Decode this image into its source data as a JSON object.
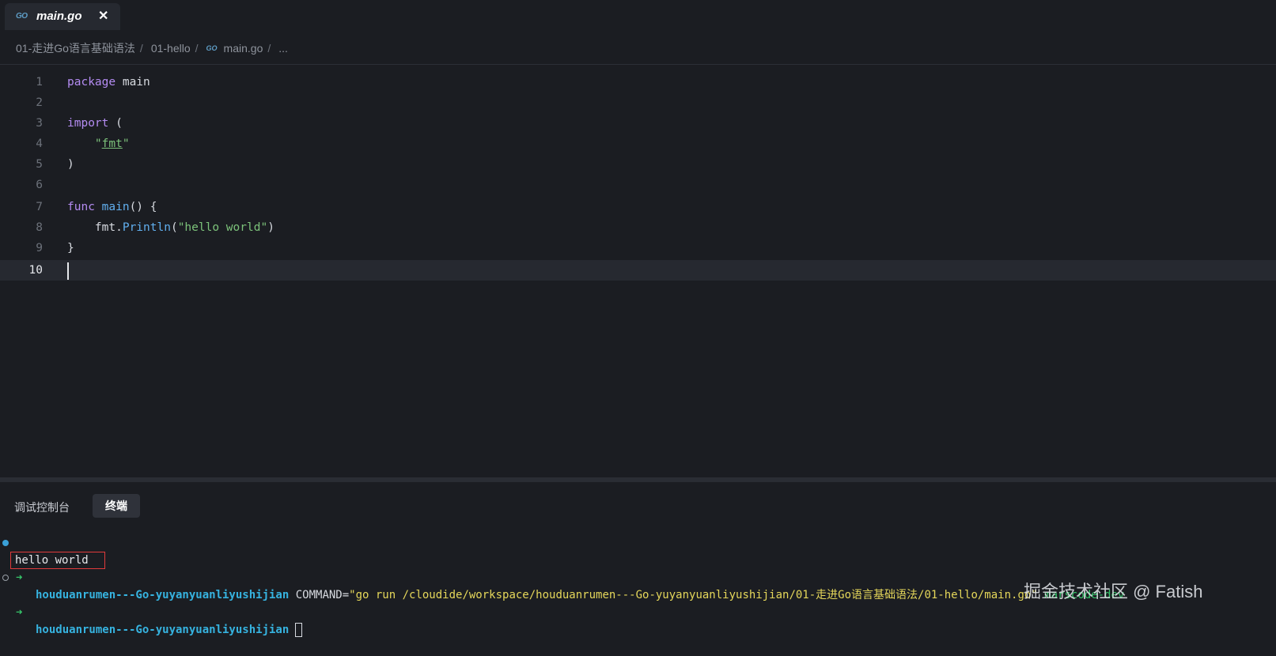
{
  "tab": {
    "icon": "GO",
    "label": "main.go",
    "close": "✕"
  },
  "breadcrumb": {
    "items": [
      "01-走进Go语言基础语法",
      "01-hello",
      "main.go",
      "..."
    ],
    "separator": "/",
    "file_icon": "GO"
  },
  "editor": {
    "line_numbers": [
      "1",
      "2",
      "3",
      "4",
      "5",
      "6",
      "7",
      "8",
      "9",
      "10"
    ],
    "active_line": 10,
    "code": {
      "l1_kw": "package",
      "l1_name": " main",
      "l3_kw": "import",
      "l3_rest": " (",
      "l4_indent": "    ",
      "l4_q1": "\"",
      "l4_str": "fmt",
      "l4_q2": "\"",
      "l5": ")",
      "l7_kw": "func",
      "l7_sp": " ",
      "l7_fn": "main",
      "l7_rest": "() {",
      "l8_indent": "    ",
      "l8_pkg": "fmt.",
      "l8_fn": "Println",
      "l8_open": "(",
      "l8_str": "\"hello world\"",
      "l8_close": ")",
      "l9": "}"
    }
  },
  "panel": {
    "tabs": [
      "调试控制台",
      "终端"
    ],
    "active_tab": "终端"
  },
  "terminal": {
    "arrow": "➜",
    "line1_dir": "houduanrumen---Go-yuyanyuanliyushijian",
    "line1_cmd": " COMMAND=",
    "line1_str": "\"go run /cloudide/workspace/houduanrumen---Go-yuyanyuanliyushijian/01-走进Go语言基础语法/01-hello/main.go\"",
    "line1_dev": " marscode-dev",
    "output": "hello world",
    "line3_dir": "houduanrumen---Go-yuyanyuanliyushijian"
  },
  "watermark": "掘金技术社区 @ Fatish",
  "colors": {
    "background": "#1b1d22",
    "keyword": "#b48cf2",
    "function": "#61afef",
    "string": "#7cc27a",
    "terminal_dir": "#36b3e0",
    "terminal_string": "#e5d75a",
    "highlight_box": "#e03b3b"
  }
}
